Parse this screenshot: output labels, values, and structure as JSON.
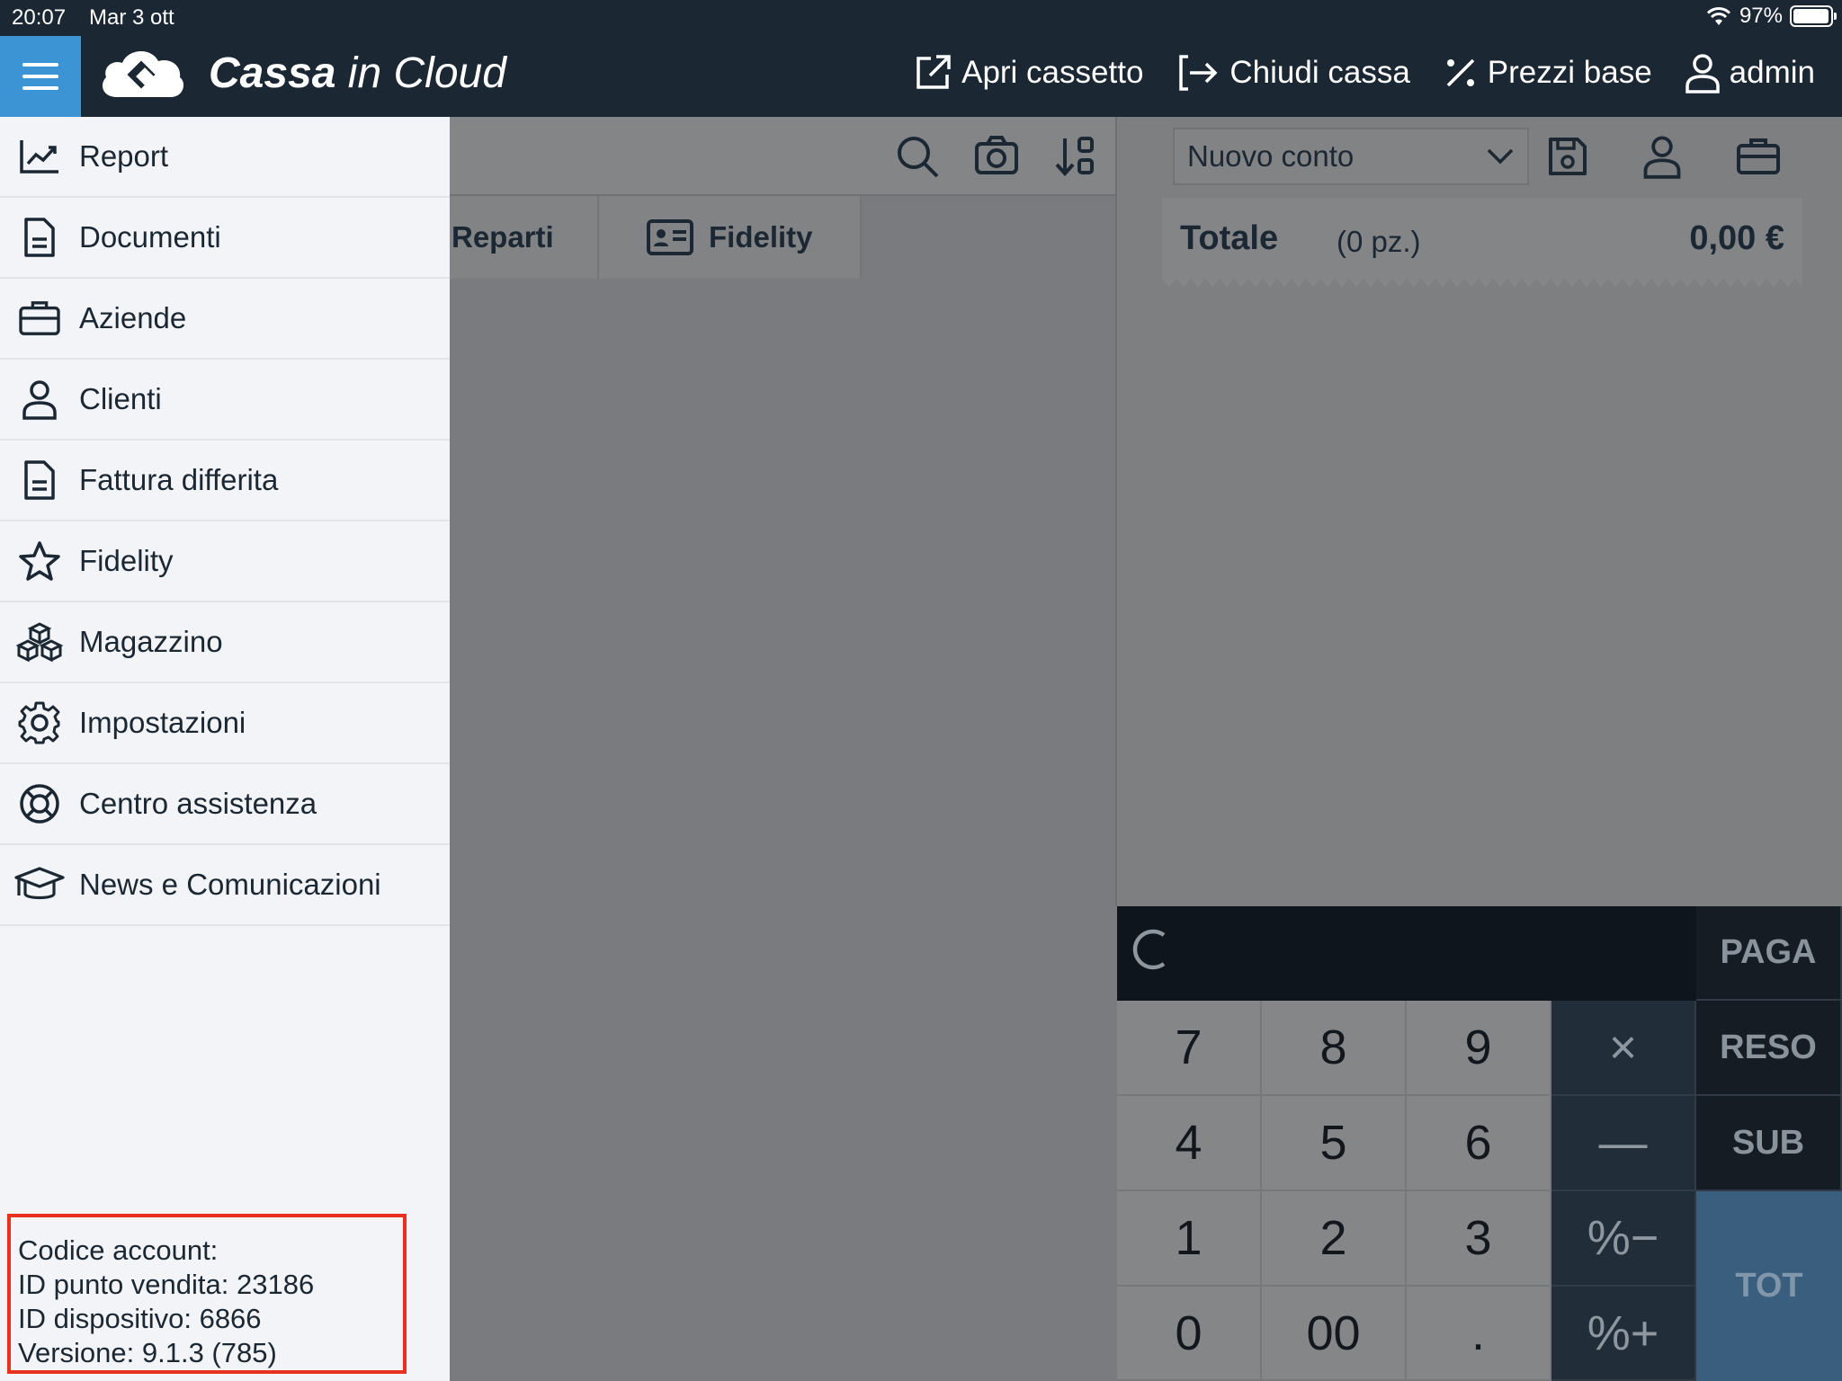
{
  "status_bar": {
    "time": "20:07",
    "date": "Mar 3 ott",
    "battery": "97%",
    "battery_level": 0.97
  },
  "app": {
    "title_bold": "Cassa",
    "title_rest": " in Cloud",
    "actions": [
      {
        "label": "Apri cassetto",
        "icon": "external-link-icon"
      },
      {
        "label": "Chiudi cassa",
        "icon": "logout-icon"
      },
      {
        "label": "Prezzi base",
        "icon": "percent-icon"
      },
      {
        "label": "admin",
        "icon": "user-icon"
      }
    ]
  },
  "drawer": {
    "items": [
      {
        "label": "Report",
        "icon": "chart-line-icon"
      },
      {
        "label": "Documenti",
        "icon": "document-icon"
      },
      {
        "label": "Aziende",
        "icon": "briefcase-icon"
      },
      {
        "label": "Clienti",
        "icon": "user-icon"
      },
      {
        "label": "Fattura differita",
        "icon": "document-icon"
      },
      {
        "label": "Fidelity",
        "icon": "star-icon"
      },
      {
        "label": "Magazzino",
        "icon": "boxes-icon"
      },
      {
        "label": "Impostazioni",
        "icon": "gear-icon"
      },
      {
        "label": "Centro assistenza",
        "icon": "lifebuoy-icon"
      },
      {
        "label": "News e Comunicazioni",
        "icon": "graduation-cap-icon"
      }
    ],
    "footer": {
      "account": "Codice account:",
      "store": "ID punto vendita: 23186",
      "device": "ID dispositivo: 6866",
      "version": "Versione: 9.1.3 (785)"
    }
  },
  "catalog": {
    "tabs": [
      {
        "label": "Reparti"
      },
      {
        "label": "Fidelity",
        "icon": "id-card-icon"
      }
    ]
  },
  "order": {
    "account_select": "Nuovo conto",
    "total_label": "Totale",
    "pieces": "(0 pz.)",
    "total_amount": "0,00 €"
  },
  "keypad": {
    "digits": [
      "7",
      "8",
      "9",
      "4",
      "5",
      "6",
      "1",
      "2",
      "3",
      "0",
      "00",
      "."
    ],
    "ops": [
      "×",
      "—",
      "%−",
      "%+"
    ],
    "side": {
      "pay": "PAGA",
      "refund": "RESO",
      "sub": "SUB",
      "tot": "TOT"
    }
  },
  "colors": {
    "topbar": "#1b2733",
    "menu_button": "#3d94d5",
    "drawer_bg": "#f2f4f7",
    "highlight_box": "#e8321f"
  }
}
